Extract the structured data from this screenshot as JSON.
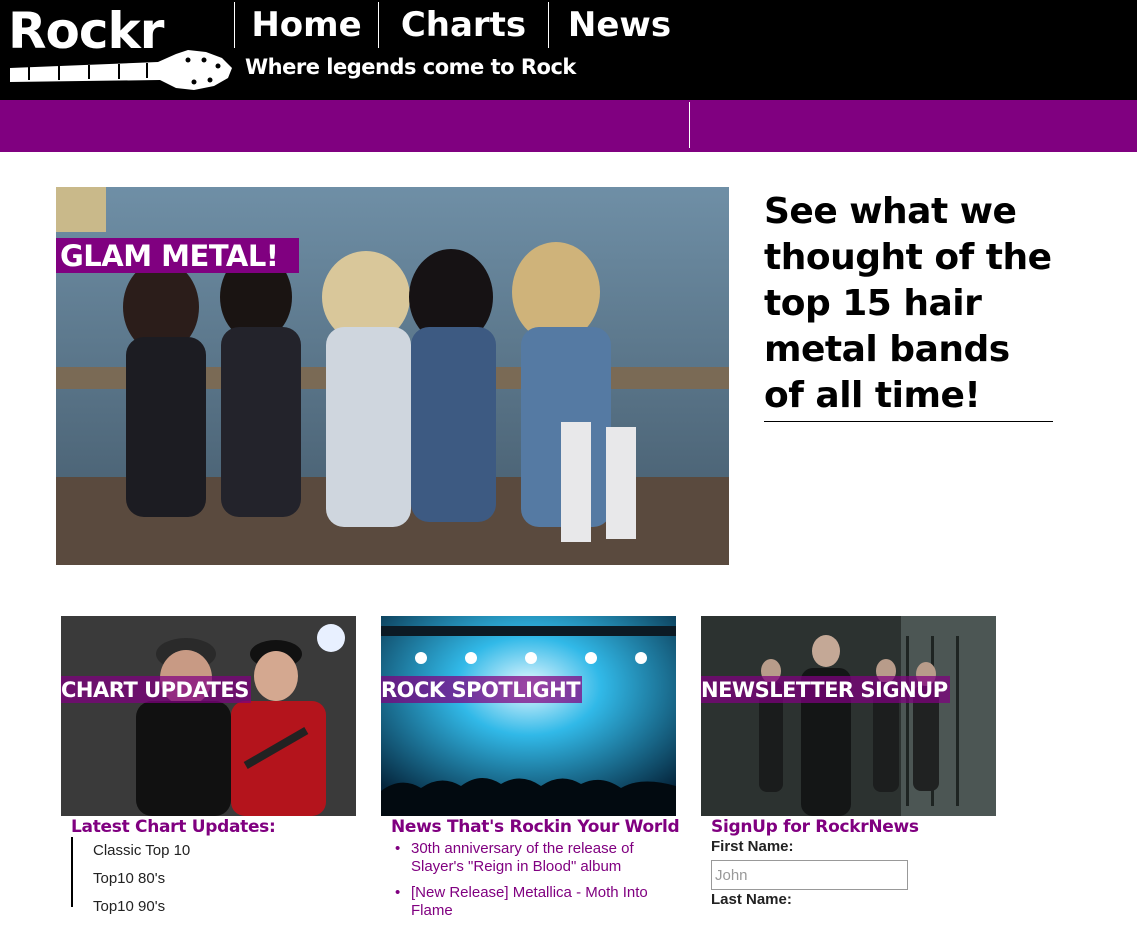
{
  "brand": {
    "logo_text": "Rockr",
    "tagline": "Where legends come to Rock"
  },
  "nav": {
    "items": [
      {
        "label": "Home"
      },
      {
        "label": "Charts"
      },
      {
        "label": "News"
      }
    ]
  },
  "hero": {
    "label": "GLAM METAL!",
    "headline": "See what we thought of the top 15 hair metal bands of all time!"
  },
  "cards": [
    {
      "label": "CHART UPDATES"
    },
    {
      "label": "ROCK SPOTLIGHT"
    },
    {
      "label": "NEWSLETTER SIGNUP"
    }
  ],
  "charts_section": {
    "title": "Latest Chart Updates:",
    "items": [
      "Classic Top 10",
      "Top10 80's",
      "Top10 90's"
    ]
  },
  "news_section": {
    "title": "News That's Rockin Your World",
    "items": [
      "30th anniversary of the release of Slayer's \"Reign in Blood\" album",
      "[New Release] Metallica - Moth Into Flame"
    ]
  },
  "signup_section": {
    "title": "SignUp for RockrNews",
    "first_name_label": "First Name:",
    "first_name_placeholder": "John",
    "last_name_label": "Last Name:"
  },
  "colors": {
    "brand_purple": "#800080",
    "header_black": "#000000"
  }
}
